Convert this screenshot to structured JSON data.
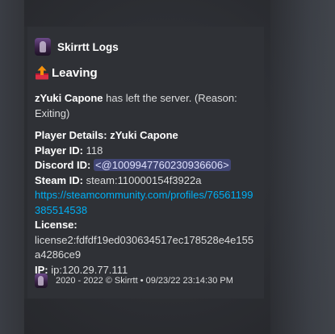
{
  "embed": {
    "author": {
      "name": "Skirrtt Logs",
      "avatar": "skirrtt-avatar"
    },
    "title": {
      "icon": "outbox-tray-icon",
      "text": "Leaving"
    },
    "description": {
      "player_name": "zYuki Capone",
      "left_text": " has left the server. (Reason: Exiting)"
    },
    "details": {
      "header_label": "Player Details:",
      "header_name": " zYuki Capone",
      "player_id_label": "Player ID:",
      "player_id": " 118",
      "discord_id_label": "Discord ID:",
      "discord_mention": "<@1009947760230936606>",
      "steam_id_label": "Steam ID:",
      "steam_id": " steam:110000154f3922a",
      "steam_link": "https://steamcommunity.com/profiles/76561199385514538",
      "license_label": "License:",
      "license": "license2:fdfdf19ed030634517ec178528e4e155a4286ce9",
      "ip_label": "IP:",
      "ip": " ip:120.29.77.111"
    },
    "footer": {
      "icon": "skirrtt-avatar",
      "text": "2020 - 2022 © Skirrtt • 09/23/22 23:14:30 PM"
    }
  },
  "colors": {
    "embed_bg": "#2f3136",
    "link": "#00aff4",
    "mention_bg": "#414675",
    "mention_text": "#dee0fc",
    "outbox_red": "#dd2e44"
  }
}
